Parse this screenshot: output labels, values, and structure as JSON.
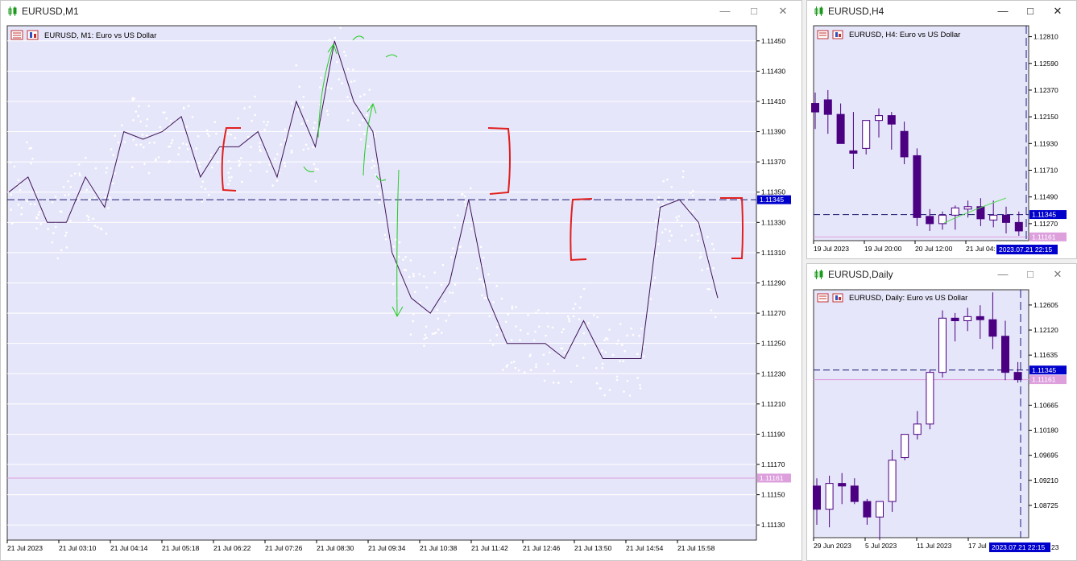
{
  "windows": {
    "m1": {
      "title": "EURUSD,M1",
      "header": "EURUSD, M1:  Euro vs US Dollar",
      "ask_price": "1.11345",
      "bid_price": "1.11161",
      "price_ticks": [
        "1.11450",
        "1.11430",
        "1.11410",
        "1.11390",
        "1.11370",
        "1.11350",
        "1.11330",
        "1.11310",
        "1.11290",
        "1.11270",
        "1.11250",
        "1.11230",
        "1.11210",
        "1.11190",
        "1.11170",
        "1.11150",
        "1.11130"
      ],
      "time_ticks": [
        "21 Jul 2023",
        "21 Jul 03:10",
        "21 Jul 04:14",
        "21 Jul 05:18",
        "21 Jul 06:22",
        "21 Jul 07:26",
        "21 Jul 08:30",
        "21 Jul 09:34",
        "21 Jul 10:38",
        "21 Jul 11:42",
        "21 Jul 12:46",
        "21 Jul 13:50",
        "21 Jul 14:54",
        "21 Jul 15:58"
      ]
    },
    "h4": {
      "title": "EURUSD,H4",
      "header": "EURUSD, H4:  Euro vs US Dollar",
      "ask_price": "1.11345",
      "bid_price": "1.11161",
      "price_ticks": [
        "1.12810",
        "1.12590",
        "1.12370",
        "1.12150",
        "1.11930",
        "1.11710",
        "1.11490",
        "1.11270"
      ],
      "time_ticks": [
        "19 Jul 2023",
        "19 Jul 20:00",
        "20 Jul 12:00",
        "21 Jul 04:"
      ],
      "current_time": "2023.07.21 22:15"
    },
    "daily": {
      "title": "EURUSD,Daily",
      "header": "EURUSD, Daily:  Euro vs US Dollar",
      "ask_price": "1.11345",
      "bid_price": "1.11161",
      "price_ticks": [
        "1.12605",
        "1.12120",
        "1.11635",
        "1.10665",
        "1.10180",
        "1.09695",
        "1.09210",
        "1.08725"
      ],
      "time_ticks": [
        "29 Jun 2023",
        "5 Jul 2023",
        "11 Jul 2023",
        "17 Jul"
      ],
      "current_time": "2023.07.21 22:15",
      "current_time_suffix": "23"
    }
  },
  "colors": {
    "chart_bg": "#e6e6fa",
    "price_line": "#3d1356",
    "ask_line": "#191970",
    "bid_line": "#dda0dd",
    "candle_bear": "#4b0082",
    "candle_bull": "#ffffff",
    "annotation_red": "#e02020",
    "annotation_green": "#22cc22",
    "label_bg": "#0000cd"
  },
  "chart_data": [
    {
      "type": "line",
      "title": "EURUSD, M1:  Euro vs US Dollar",
      "x": [
        "21 Jul 02:00",
        "21 Jul 02:30",
        "21 Jul 03:10",
        "21 Jul 03:40",
        "21 Jul 04:00",
        "21 Jul 04:14",
        "21 Jul 04:40",
        "21 Jul 05:18",
        "21 Jul 05:50",
        "21 Jul 06:22",
        "21 Jul 06:55",
        "21 Jul 07:26",
        "21 Jul 07:50",
        "21 Jul 08:10",
        "21 Jul 08:30",
        "21 Jul 08:50",
        "21 Jul 09:20",
        "21 Jul 09:34",
        "21 Jul 09:50",
        "21 Jul 10:05",
        "21 Jul 10:20",
        "21 Jul 10:38",
        "21 Jul 11:00",
        "21 Jul 11:20",
        "21 Jul 11:42",
        "21 Jul 12:05",
        "21 Jul 12:30",
        "21 Jul 12:46",
        "21 Jul 13:10",
        "21 Jul 13:35",
        "21 Jul 13:50",
        "21 Jul 14:10",
        "21 Jul 14:30",
        "21 Jul 14:54",
        "21 Jul 15:20",
        "21 Jul 15:40",
        "21 Jul 15:58",
        "21 Jul 16:20"
      ],
      "y": [
        1.1135,
        1.1136,
        1.1133,
        1.1133,
        1.1136,
        1.1134,
        1.1139,
        1.11385,
        1.1139,
        1.114,
        1.1136,
        1.1138,
        1.1138,
        1.1139,
        1.1136,
        1.1141,
        1.1138,
        1.1145,
        1.1141,
        1.1139,
        1.1131,
        1.1128,
        1.1127,
        1.1129,
        1.11345,
        1.1128,
        1.1125,
        1.1125,
        1.1125,
        1.1124,
        1.11265,
        1.1124,
        1.1124,
        1.1124,
        1.1134,
        1.11345,
        1.1133,
        1.1128
      ],
      "ylim": [
        1.1112,
        1.1146
      ],
      "ask_line": 1.11345,
      "bid_line": 1.11161
    },
    {
      "type": "candlestick",
      "title": "EURUSD, H4:  Euro vs US Dollar",
      "x": [
        "19 Jul 2023",
        "19 Jul 04:00",
        "19 Jul 08:00",
        "19 Jul 12:00",
        "19 Jul 16:00",
        "19 Jul 20:00",
        "20 Jul 00:00",
        "20 Jul 04:00",
        "20 Jul 08:00",
        "20 Jul 12:00",
        "20 Jul 16:00",
        "20 Jul 20:00",
        "21 Jul 00:00",
        "21 Jul 04:00",
        "21 Jul 08:00",
        "21 Jul 12:00",
        "21 Jul 16:00"
      ],
      "open": [
        1.1226,
        1.1229,
        1.1217,
        1.1187,
        1.1189,
        1.1212,
        1.1216,
        1.1203,
        1.1183,
        1.1133,
        1.1127,
        1.1134,
        1.1139,
        1.1141,
        1.113,
        1.1134,
        1.1128
      ],
      "high": [
        1.1235,
        1.1237,
        1.1226,
        1.1219,
        1.1201,
        1.1222,
        1.1219,
        1.1211,
        1.1189,
        1.1139,
        1.1137,
        1.1142,
        1.1146,
        1.1148,
        1.1146,
        1.1141,
        1.1137
      ],
      "low": [
        1.1205,
        1.1201,
        1.1198,
        1.1172,
        1.1184,
        1.1198,
        1.1188,
        1.1176,
        1.1125,
        1.1121,
        1.1122,
        1.1122,
        1.1132,
        1.1125,
        1.1124,
        1.1119,
        1.1117
      ],
      "close": [
        1.1219,
        1.1217,
        1.1193,
        1.1185,
        1.1212,
        1.1216,
        1.1209,
        1.1182,
        1.1132,
        1.1127,
        1.1134,
        1.114,
        1.1141,
        1.1131,
        1.1134,
        1.1128,
        1.1121
      ],
      "ylim": [
        1.1113,
        1.129
      ],
      "ask_line": 1.11345,
      "bid_line": 1.11161
    },
    {
      "type": "candlestick",
      "title": "EURUSD, Daily:  Euro vs US Dollar",
      "x": [
        "29 Jun 2023",
        "30 Jun 2023",
        "3 Jul 2023",
        "4 Jul 2023",
        "5 Jul 2023",
        "6 Jul 2023",
        "7 Jul 2023",
        "10 Jul 2023",
        "11 Jul 2023",
        "12 Jul 2023",
        "13 Jul 2023",
        "14 Jul 2023",
        "17 Jul 2023",
        "18 Jul 2023",
        "19 Jul 2023",
        "20 Jul 2023",
        "21 Jul 2023"
      ],
      "open": [
        1.091,
        1.0865,
        1.0915,
        1.091,
        1.088,
        1.085,
        1.088,
        1.0965,
        1.101,
        1.103,
        1.113,
        1.1235,
        1.123,
        1.1238,
        1.1232,
        1.12,
        1.113
      ],
      "high": [
        1.0925,
        1.093,
        1.0935,
        1.0925,
        1.0885,
        1.088,
        1.098,
        1.0995,
        1.1055,
        1.1135,
        1.125,
        1.1245,
        1.1255,
        1.126,
        1.1285,
        1.123,
        1.115
      ],
      "low": [
        1.0835,
        1.083,
        1.0875,
        1.0875,
        1.0835,
        1.0805,
        1.086,
        1.096,
        1.1,
        1.102,
        1.112,
        1.119,
        1.121,
        1.1195,
        1.1175,
        1.1115,
        1.111
      ],
      "close": [
        1.0865,
        1.0915,
        1.091,
        1.088,
        1.085,
        1.088,
        1.096,
        1.101,
        1.103,
        1.113,
        1.1235,
        1.123,
        1.1238,
        1.1232,
        1.12,
        1.113,
        1.1116
      ],
      "ylim": [
        1.081,
        1.129
      ],
      "ask_line": 1.11345,
      "bid_line": 1.11161
    }
  ]
}
